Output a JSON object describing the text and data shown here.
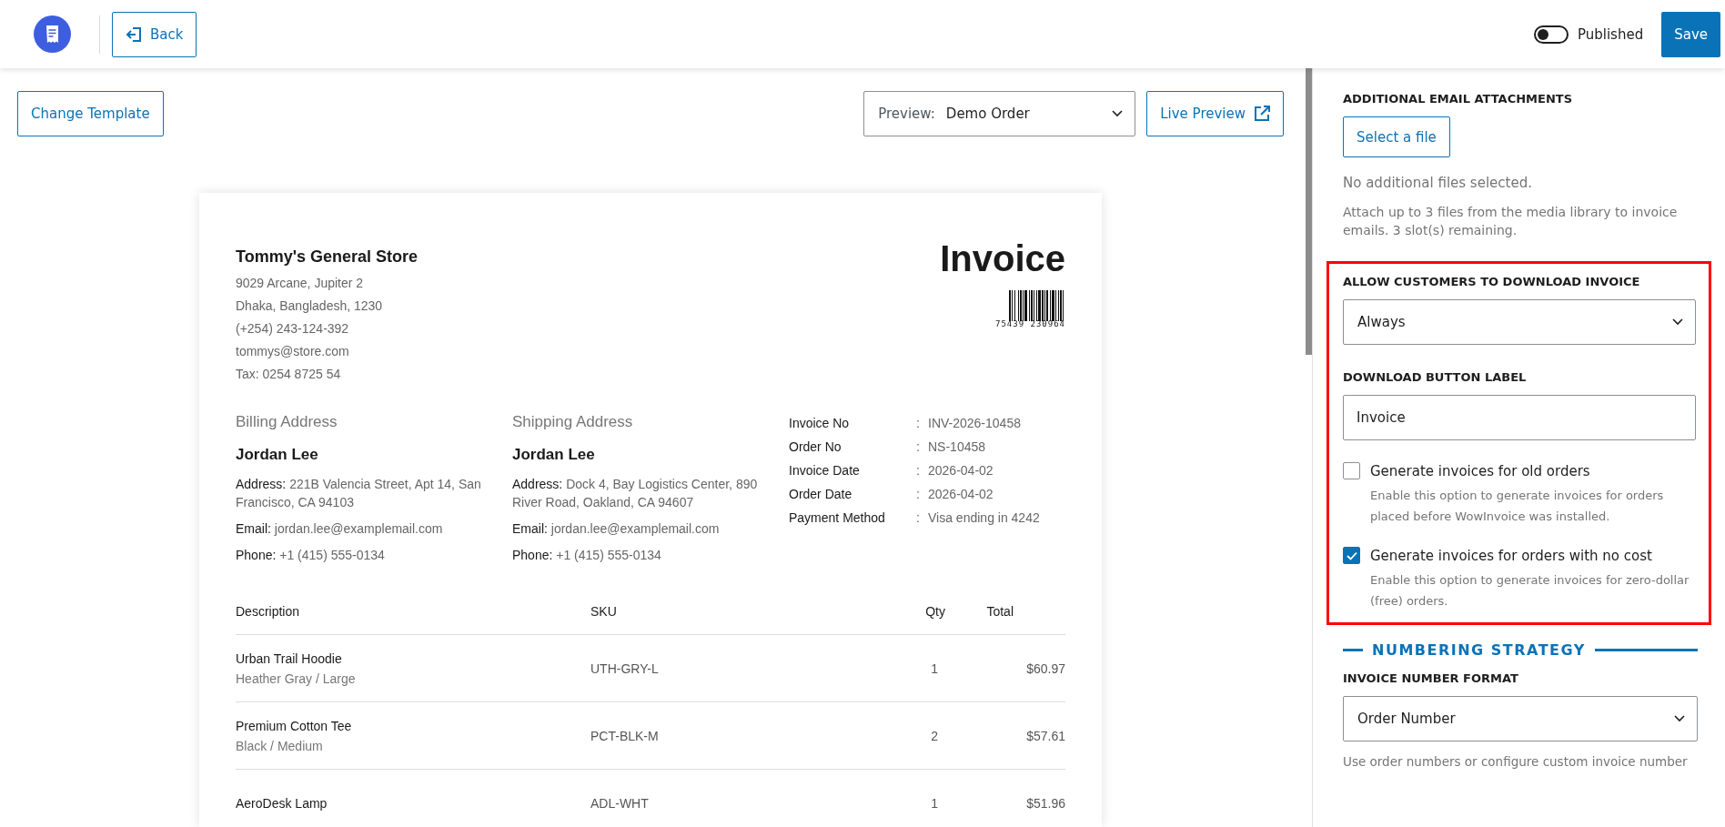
{
  "topbar": {
    "back": "Back",
    "published": {
      "label": "Published",
      "on": false
    },
    "save": "Save"
  },
  "toolbar": {
    "change_template": "Change Template",
    "preview_label": "Preview:",
    "preview_value": "Demo Order",
    "live_preview": "Live Preview"
  },
  "invoice": {
    "store": {
      "name": "Tommy's General Store",
      "lines": [
        "9029 Arcane, Jupiter 2",
        "Dhaka, Bangladesh, 1230",
        "(+254) 243-124-392",
        "tommys@store.com",
        "Tax: 0254 8725 54"
      ]
    },
    "title": "Invoice",
    "barcode_number": "75439  230964",
    "addresses": [
      {
        "heading": "Billing Address",
        "name": "Jordan Lee",
        "fields": [
          {
            "label": "Address:",
            "value": "221B Valencia Street, Apt 14, San Francisco, CA 94103"
          },
          {
            "label": "Email:",
            "value": "jordan.lee@examplemail.com"
          },
          {
            "label": "Phone:",
            "value": "+1 (415) 555-0134"
          }
        ]
      },
      {
        "heading": "Shipping Address",
        "name": "Jordan Lee",
        "fields": [
          {
            "label": "Address:",
            "value": "Dock 4, Bay Logistics Center, 890 River Road, Oakland, CA 94607"
          },
          {
            "label": "Email:",
            "value": "jordan.lee@examplemail.com"
          },
          {
            "label": "Phone:",
            "value": "+1 (415) 555-0134"
          }
        ]
      }
    ],
    "meta": [
      {
        "label": "Invoice No",
        "separator": ":",
        "value": "INV-2026-10458"
      },
      {
        "label": "Order No",
        "separator": ":",
        "value": "NS-10458"
      },
      {
        "label": "Invoice Date",
        "separator": ":",
        "value": "2026-04-02"
      },
      {
        "label": "Order Date",
        "separator": ":",
        "value": "2026-04-02"
      },
      {
        "label": "Payment Method",
        "separator": ":",
        "value": "Visa ending in 4242"
      }
    ],
    "columns": [
      "Description",
      "SKU",
      "Qty",
      "Total"
    ],
    "rows": [
      {
        "name": "Urban Trail Hoodie",
        "variant": "Heather Gray / Large",
        "sku": "UTH-GRY-L",
        "qty": "1",
        "total": "$60.97"
      },
      {
        "name": "Premium Cotton Tee",
        "variant": "Black / Medium",
        "sku": "PCT-BLK-M",
        "qty": "2",
        "total": "$57.61"
      },
      {
        "name": "AeroDesk Lamp",
        "sku": "ADL-WHT",
        "qty": "1",
        "total": "$51.96"
      }
    ]
  },
  "settings": {
    "attachments": {
      "heading": "ADDITIONAL EMAIL ATTACHMENTS",
      "button": "Select a file",
      "status": "No additional files selected.",
      "help": "Attach up to 3 files from the media library to invoice emails. 3 slot(s) remaining."
    },
    "download": {
      "heading": "ALLOW CUSTOMERS TO DOWNLOAD INVOICE",
      "value": "Always"
    },
    "label_field": {
      "heading": "DOWNLOAD BUTTON LABEL",
      "value": "Invoice"
    },
    "options": [
      {
        "label": "Generate invoices for old orders",
        "help": "Enable this option to generate invoices for orders placed before WowInvoice was installed.",
        "checked": false
      },
      {
        "label": "Generate invoices for orders with no cost",
        "help": "Enable this option to generate invoices for zero-dollar (free) orders.",
        "checked": true
      }
    ],
    "section": "NUMBERING STRATEGY",
    "number_format": {
      "heading": "INVOICE NUMBER FORMAT",
      "value": "Order Number",
      "help": "Use order numbers or configure custom invoice number"
    }
  }
}
